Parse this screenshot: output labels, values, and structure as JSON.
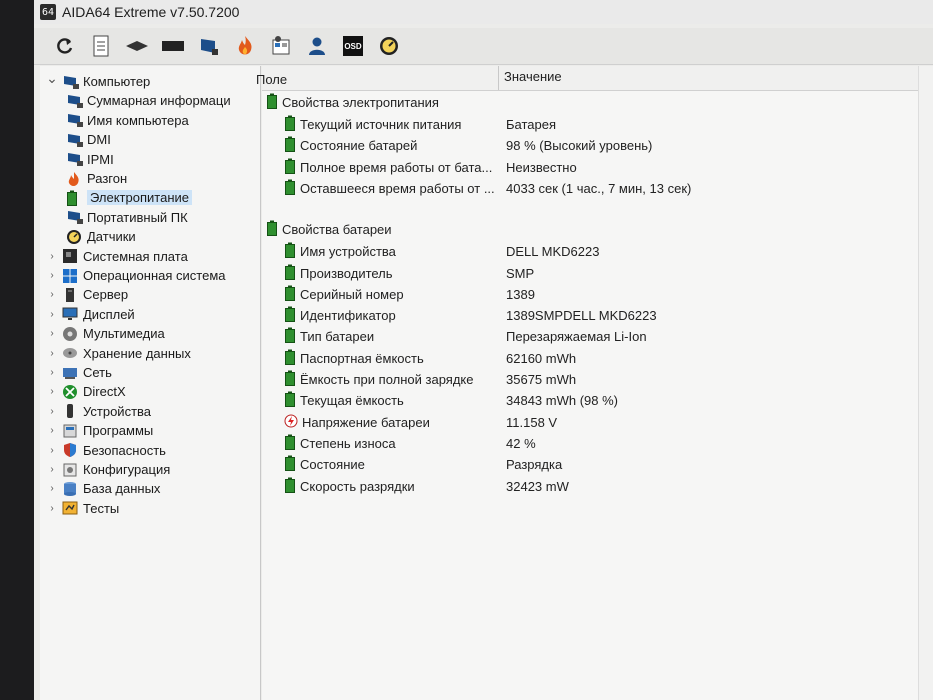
{
  "window": {
    "title": "AIDA64 Extreme v7.50.7200",
    "app_icon_text": "64"
  },
  "toolbar": {
    "buttons": [
      {
        "name": "refresh-icon"
      },
      {
        "name": "report-icon"
      },
      {
        "name": "memory-icon"
      },
      {
        "name": "cpu-icon"
      },
      {
        "name": "computer-icon"
      },
      {
        "name": "flame-icon"
      },
      {
        "name": "tools-icon"
      },
      {
        "name": "user-icon"
      },
      {
        "name": "osd-icon",
        "label": "OSD"
      },
      {
        "name": "gauge-icon"
      }
    ]
  },
  "tree": {
    "items": [
      {
        "label": "Компьютер",
        "level": 0,
        "expanded": true,
        "icon": "computer-icon"
      },
      {
        "label": "Суммарная информаци",
        "level": 1,
        "icon": "computer-icon"
      },
      {
        "label": "Имя компьютера",
        "level": 1,
        "icon": "computer-icon"
      },
      {
        "label": "DMI",
        "level": 1,
        "icon": "computer-icon"
      },
      {
        "label": "IPMI",
        "level": 1,
        "icon": "computer-icon"
      },
      {
        "label": "Разгон",
        "level": 1,
        "icon": "flame-icon"
      },
      {
        "label": "Электропитание",
        "level": 1,
        "icon": "battery-icon",
        "selected": true
      },
      {
        "label": "Портативный ПК",
        "level": 1,
        "icon": "computer-icon"
      },
      {
        "label": "Датчики",
        "level": 1,
        "icon": "gauge-icon"
      },
      {
        "label": "Системная плата",
        "level": 0,
        "icon": "motherboard-icon"
      },
      {
        "label": "Операционная система",
        "level": 0,
        "icon": "windows-icon"
      },
      {
        "label": "Сервер",
        "level": 0,
        "icon": "server-icon"
      },
      {
        "label": "Дисплей",
        "level": 0,
        "icon": "display-icon"
      },
      {
        "label": "Мультимедиа",
        "level": 0,
        "icon": "multimedia-icon"
      },
      {
        "label": "Хранение данных",
        "level": 0,
        "icon": "storage-icon"
      },
      {
        "label": "Сеть",
        "level": 0,
        "icon": "network-icon"
      },
      {
        "label": "DirectX",
        "level": 0,
        "icon": "xbox-icon"
      },
      {
        "label": "Устройства",
        "level": 0,
        "icon": "devices-icon"
      },
      {
        "label": "Программы",
        "level": 0,
        "icon": "programs-icon"
      },
      {
        "label": "Безопасность",
        "level": 0,
        "icon": "shield-icon"
      },
      {
        "label": "Конфигурация",
        "level": 0,
        "icon": "config-icon"
      },
      {
        "label": "База данных",
        "level": 0,
        "icon": "database-icon"
      },
      {
        "label": "Тесты",
        "level": 0,
        "icon": "tests-icon"
      }
    ]
  },
  "columns": {
    "field": "Поле",
    "value": "Значение"
  },
  "sections": [
    {
      "title": "Свойства электропитания",
      "rows": [
        {
          "field": "Текущий источник питания",
          "value": "Батарея",
          "icon": "battery-icon"
        },
        {
          "field": "Состояние батарей",
          "value": "98 % (Высокий уровень)",
          "icon": "battery-icon"
        },
        {
          "field": "Полное время работы от бата...",
          "value": "Неизвестно",
          "icon": "battery-icon"
        },
        {
          "field": "Оставшееся время работы от ...",
          "value": "4033 сек (1 час., 7 мин, 13 сек)",
          "icon": "battery-icon"
        }
      ]
    },
    {
      "title": "Свойства батареи",
      "rows": [
        {
          "field": "Имя устройства",
          "value": "DELL MKD6223",
          "icon": "battery-icon"
        },
        {
          "field": "Производитель",
          "value": "SMP",
          "icon": "battery-icon"
        },
        {
          "field": "Серийный номер",
          "value": "1389",
          "icon": "battery-icon"
        },
        {
          "field": "Идентификатор",
          "value": "1389SMPDELL MKD6223",
          "icon": "battery-icon"
        },
        {
          "field": "Тип батареи",
          "value": "Перезаряжаемая Li-Ion",
          "icon": "battery-icon"
        },
        {
          "field": "Паспортная ёмкость",
          "value": "62160 mWh",
          "icon": "battery-icon"
        },
        {
          "field": "Ёмкость при полной зарядке",
          "value": "35675 mWh",
          "icon": "battery-icon"
        },
        {
          "field": "Текущая ёмкость",
          "value": "34843 mWh  (98 %)",
          "icon": "battery-icon"
        },
        {
          "field": "Напряжение батареи",
          "value": "11.158 V",
          "icon": "voltage-icon"
        },
        {
          "field": "Степень износа",
          "value": "42 %",
          "icon": "battery-icon"
        },
        {
          "field": "Состояние",
          "value": "Разрядка",
          "icon": "battery-icon"
        },
        {
          "field": "Скорость разрядки",
          "value": "32423 mW",
          "icon": "battery-icon"
        }
      ]
    }
  ]
}
